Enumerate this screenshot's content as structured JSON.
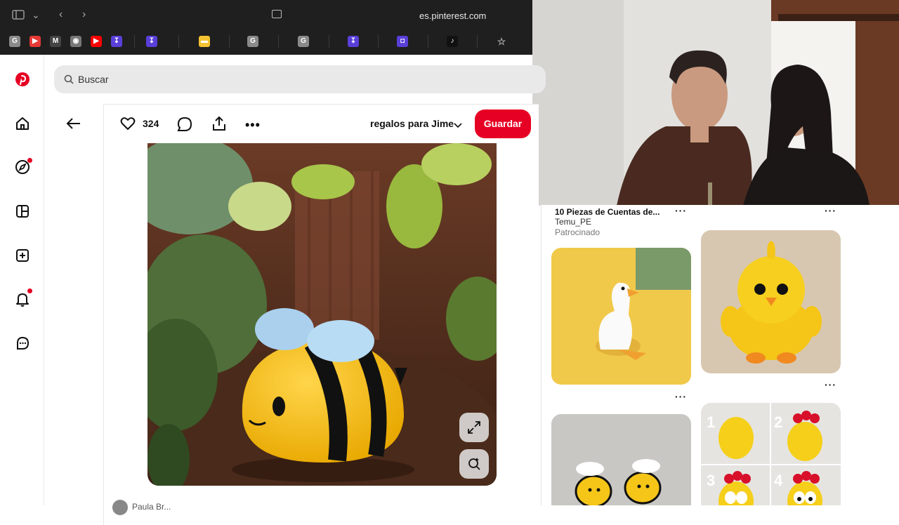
{
  "browser": {
    "url": "es.pinterest.com",
    "tabs": [
      {
        "icon": "g-favicon-icon",
        "letter": "G",
        "color": "#8a8a8a"
      },
      {
        "icon": "youtube-music-icon",
        "letter": "▶",
        "color": "#e53935"
      },
      {
        "icon": "gmail-icon",
        "letter": "M",
        "color": "#444"
      },
      {
        "icon": "headphones-icon",
        "letter": "◉",
        "color": "#777"
      },
      {
        "icon": "youtube-icon",
        "letter": "▶",
        "color": "#ff0000"
      },
      {
        "icon": "app-icon",
        "letter": "↧",
        "color": "#5a3fd9"
      },
      {
        "icon": "app-icon",
        "letter": "↧",
        "color": "#5a3fd9"
      },
      {
        "icon": "miro-icon",
        "letter": "▬",
        "color": "#f2c230"
      },
      {
        "icon": "g-favicon-icon",
        "letter": "G",
        "color": "#8a8a8a"
      },
      {
        "icon": "g-favicon-icon",
        "letter": "G",
        "color": "#8a8a8a"
      },
      {
        "icon": "app-icon",
        "letter": "↧",
        "color": "#5a3fd9"
      },
      {
        "icon": "app-icon",
        "letter": "◘",
        "color": "#5a3fd9"
      },
      {
        "icon": "tiktok-icon",
        "letter": "♪",
        "color": "#111"
      },
      {
        "icon": "star-icon",
        "letter": "☆",
        "color": "transparent"
      }
    ]
  },
  "search": {
    "placeholder": "Buscar"
  },
  "pin": {
    "likes": "324",
    "board": "regalos para Jime",
    "save_label": "Guardar",
    "author": "Paula Br..."
  },
  "related": [
    {
      "title": "10 Piezas de Cuentas de...",
      "subtitle": "Temu_PE",
      "label": "Patrocinado"
    }
  ],
  "colors": {
    "brand": "#e60023",
    "search_bg": "#e9e9e9"
  }
}
